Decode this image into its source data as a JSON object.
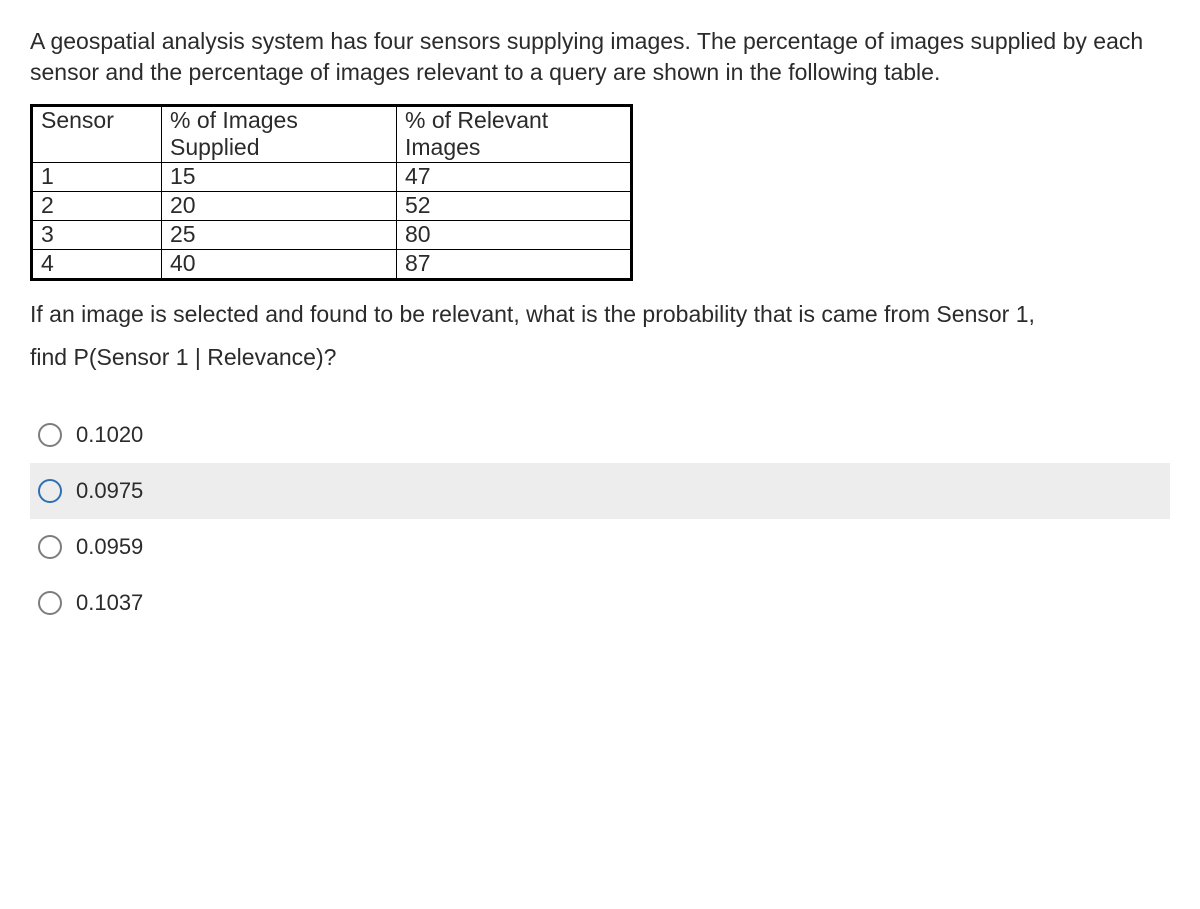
{
  "question": {
    "intro": "A geospatial analysis system has four sensors supplying images. The percentage of images supplied by each sensor and the percentage of images relevant to a query are shown in the following table.",
    "followup": "If an image is selected and found to be relevant, what is the probability that is came from Sensor 1,",
    "prompt": "find P(Sensor 1 | Relevance)?"
  },
  "table": {
    "headers": {
      "c0": "Sensor",
      "c1": "% of Images Supplied",
      "c2": "% of Relevant Images"
    },
    "rows": [
      {
        "c0": "1",
        "c1": "15",
        "c2": "47"
      },
      {
        "c0": "2",
        "c1": "20",
        "c2": "52"
      },
      {
        "c0": "3",
        "c1": "25",
        "c2": "80"
      },
      {
        "c0": "4",
        "c1": "40",
        "c2": "87"
      }
    ]
  },
  "options": [
    {
      "label": "0.1020"
    },
    {
      "label": "0.0975"
    },
    {
      "label": "0.0959"
    },
    {
      "label": "0.1037"
    }
  ]
}
